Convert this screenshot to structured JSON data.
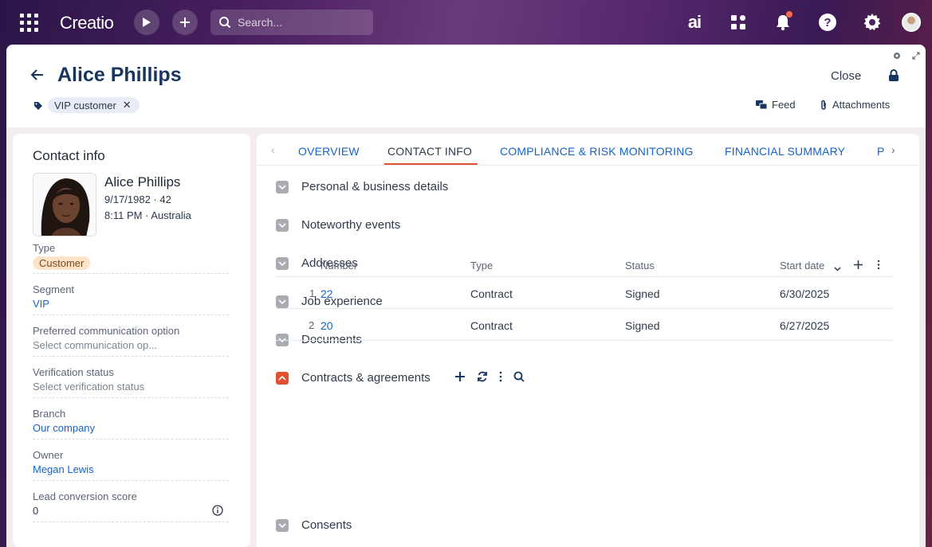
{
  "topbar": {
    "logo": "Creatio",
    "search_placeholder": "Search...",
    "ai_label": "ai"
  },
  "header": {
    "title": "Alice Phillips",
    "tag": "VIP customer",
    "close_label": "Close",
    "feed_label": "Feed",
    "attachments_label": "Attachments"
  },
  "contact_info": {
    "heading": "Contact info",
    "name": "Alice Phillips",
    "birth": "9/17/1982 · 42",
    "local_time": "8:11 PM · Australia",
    "fields": {
      "type": {
        "label": "Type",
        "value": "Customer"
      },
      "segment": {
        "label": "Segment",
        "value": "VIP"
      },
      "communication": {
        "label": "Preferred communication option",
        "value": "Select communication op..."
      },
      "verification": {
        "label": "Verification status",
        "value": "Select verification status"
      },
      "branch": {
        "label": "Branch",
        "value": "Our company"
      },
      "owner": {
        "label": "Owner",
        "value": "Megan Lewis"
      },
      "lead_score": {
        "label": "Lead conversion score",
        "value": "0"
      }
    }
  },
  "tabs": [
    "OVERVIEW",
    "CONTACT INFO",
    "COMPLIANCE & RISK MONITORING",
    "FINANCIAL SUMMARY",
    "P"
  ],
  "active_tab": "CONTACT INFO",
  "sections": [
    "Personal & business details",
    "Noteworthy events",
    "Addresses",
    "Job experience",
    "Documents",
    "Contracts & agreements",
    "Consents"
  ],
  "contracts": {
    "columns": [
      "Number",
      "Type",
      "Status",
      "Start date"
    ],
    "rows": [
      {
        "index": "1",
        "number": "22",
        "type": "Contract",
        "status": "Signed",
        "start": "6/30/2025"
      },
      {
        "index": "2",
        "number": "20",
        "type": "Contract",
        "status": "Signed",
        "start": "6/27/2025"
      }
    ]
  },
  "colors": {
    "accent": "#e0522f",
    "link": "#1563c8",
    "title": "#17355e"
  }
}
